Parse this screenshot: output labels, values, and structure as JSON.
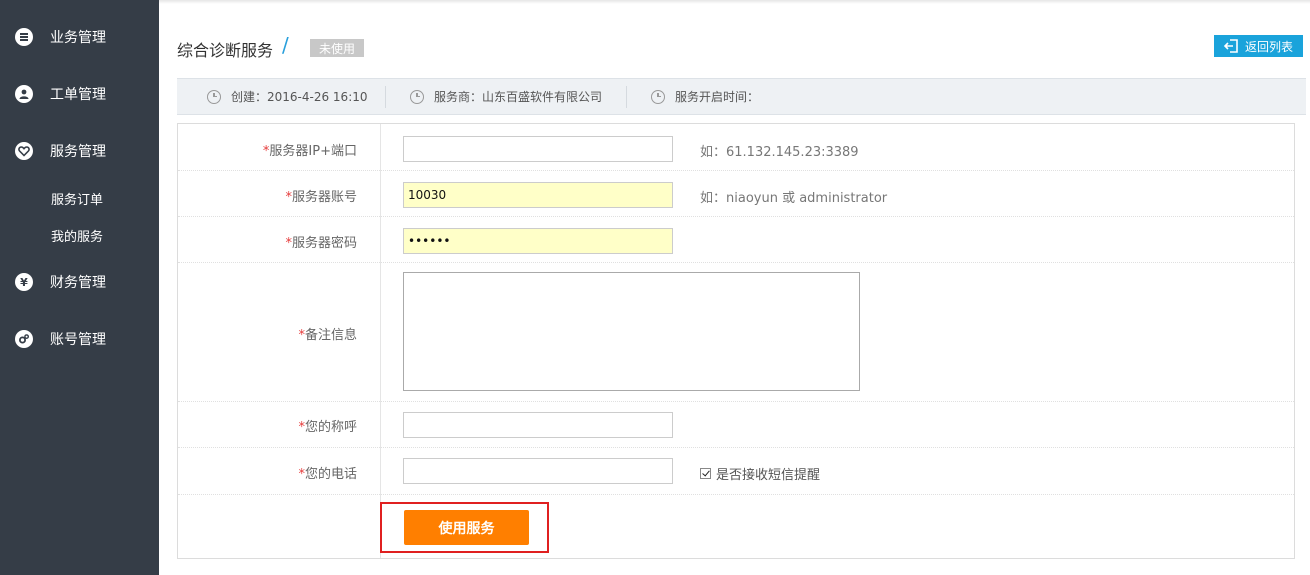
{
  "sidebar": {
    "items": [
      {
        "label": "业务管理",
        "icon": "list-icon"
      },
      {
        "label": "工单管理",
        "icon": "user-icon"
      },
      {
        "label": "服务管理",
        "icon": "heart-icon"
      },
      {
        "label": "财务管理",
        "icon": "yen-icon"
      },
      {
        "label": "账号管理",
        "icon": "gear-icon"
      }
    ],
    "subitems": [
      "服务订单",
      "我的服务"
    ],
    "yen_glyph": "¥"
  },
  "header": {
    "title": "综合诊断服务",
    "separator": "/",
    "status": "未使用",
    "back_label": "返回列表"
  },
  "info": {
    "created": "创建：2016-4-26 16:10",
    "provider": "服务商：山东百盛软件有限公司",
    "start_time": "服务开启时间："
  },
  "form": {
    "required_mark": "*",
    "fields": [
      {
        "label": "服务器IP+端口",
        "value": "",
        "hint": "如：61.132.145.23:3389"
      },
      {
        "label": "服务器账号",
        "value": "10030",
        "hint": "如：niaoyun 或 administrator"
      },
      {
        "label": "服务器密码",
        "value": "••••••",
        "hint": ""
      },
      {
        "label": "备注信息",
        "value": "",
        "hint": ""
      },
      {
        "label": "您的称呼",
        "value": "",
        "hint": ""
      },
      {
        "label": "您的电话",
        "value": "",
        "hint": ""
      }
    ],
    "sms_label": "是否接收短信提醒",
    "sms_checked": true,
    "submit_label": "使用服务"
  },
  "colors": {
    "sidebar_bg": "#353d47",
    "accent_blue": "#1aa3db",
    "submit_orange": "#ff7f00",
    "highlight_red": "#e02020",
    "autofill_yellow": "#ffffc8"
  }
}
